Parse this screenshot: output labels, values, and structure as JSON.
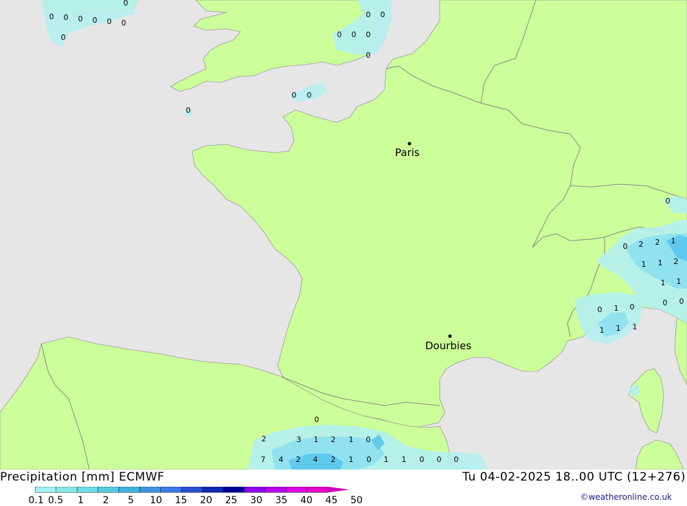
{
  "map": {
    "cities": [
      {
        "name": "Paris"
      },
      {
        "name": "Dourbies"
      }
    ],
    "precip_labels": [
      "0",
      "0",
      "0",
      "0",
      "0",
      "0",
      "0",
      "0",
      "0",
      "0",
      "0",
      "0",
      "0",
      "0",
      "0",
      "0",
      "0",
      "0",
      "0",
      "2",
      "2",
      "1",
      "1",
      "1",
      "2",
      "1",
      "1",
      "0",
      "0",
      "0",
      "1",
      "0",
      "1",
      "1",
      "1",
      "0",
      "2",
      "3",
      "1",
      "2",
      "1",
      "0",
      "7",
      "4",
      "2",
      "4",
      "2",
      "1",
      "0",
      "1",
      "1",
      "0",
      "0",
      "0"
    ]
  },
  "legend": {
    "title": "Precipitation [mm] ECMWF",
    "run": "Tu 04-02-2025 18..00 UTC (12+276)",
    "credit": "©weatheronline.co.uk",
    "levels": [
      "0.1",
      "0.5",
      "1",
      "2",
      "5",
      "10",
      "15",
      "20",
      "25",
      "30",
      "35",
      "40",
      "45",
      "50"
    ],
    "colors": [
      "#a0f0f0",
      "#86e6ea",
      "#6cdce6",
      "#52cce0",
      "#3cb4dc",
      "#3c96dc",
      "#3c78e6",
      "#2850d2",
      "#1428b4",
      "#000096",
      "#8c00e6",
      "#b400e6",
      "#dc00e6",
      "#e600c8",
      "#c800b4"
    ]
  },
  "colors": {
    "land": "#ccff99",
    "sea": "#e6e6e6",
    "border": "#888888",
    "rain_light": "#b4f0f0",
    "rain_mid": "#8ce0f0",
    "rain_heavy": "#5ac8ec"
  }
}
